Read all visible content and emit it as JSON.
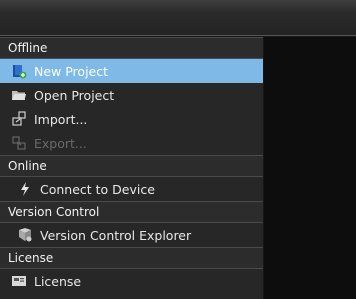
{
  "sections": {
    "offline": {
      "header": "Offline",
      "items": [
        {
          "label": "New Project",
          "icon": "new-project-icon"
        },
        {
          "label": "Open Project",
          "icon": "folder-icon"
        },
        {
          "label": "Import...",
          "icon": "import-icon"
        },
        {
          "label": "Export...",
          "icon": "export-icon"
        }
      ]
    },
    "online": {
      "header": "Online",
      "items": [
        {
          "label": "Connect to Device",
          "icon": "lightning-icon"
        }
      ]
    },
    "version_control": {
      "header": "Version Control",
      "items": [
        {
          "label": "Version Control Explorer",
          "icon": "version-control-icon"
        }
      ]
    },
    "license": {
      "header": "License",
      "items": [
        {
          "label": "License",
          "icon": "license-icon"
        }
      ]
    }
  },
  "colors": {
    "selected": "#7fb9e8",
    "panel": "#272727",
    "content": "#0d0d0d"
  }
}
